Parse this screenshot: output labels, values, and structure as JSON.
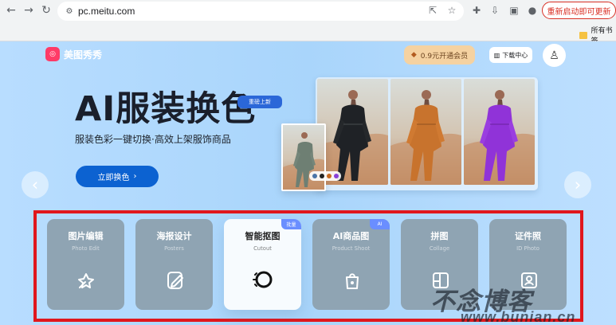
{
  "browser": {
    "url": "pc.meitu.com",
    "update_label": "重新启动即可更新",
    "bookmark_folder": "所有书签",
    "icons": [
      "back-icon",
      "forward-icon",
      "reload-icon",
      "share-icon",
      "star-icon",
      "extension-icon",
      "download-icon",
      "sidebar-icon",
      "profile-icon"
    ]
  },
  "header": {
    "brand": "美图秀秀",
    "vip_label": "0.9元开通会员",
    "download_label": "下载中心",
    "avatar_icon": "user-icon"
  },
  "hero": {
    "title": "AI服装换色",
    "badge": "重磅上新",
    "subtitle": "服装色彩一键切换·高效上架服饰商品",
    "cta": "立即换色",
    "swatch_colors": [
      "#4b75a8",
      "#222222",
      "#c86b22",
      "#8a40d9"
    ],
    "outfit_colors": [
      "#6e7f73",
      "#202226",
      "#c8732d",
      "#9033d8"
    ]
  },
  "tools": [
    {
      "title": "图片编辑",
      "subtitle": "Photo Edit",
      "icon": "magic-wand-icon",
      "active": false
    },
    {
      "title": "海报设计",
      "subtitle": "Posters",
      "icon": "edit-document-icon",
      "active": false
    },
    {
      "title": "智能抠图",
      "subtitle": "Cutout",
      "icon": "cutout-circle-icon",
      "active": true,
      "badge": "批量"
    },
    {
      "title": "AI商品图",
      "subtitle": "Product Shoot",
      "icon": "ai-product-bag-icon",
      "active": false,
      "badge": "AI"
    },
    {
      "title": "拼图",
      "subtitle": "Collage",
      "icon": "collage-grid-icon",
      "active": false
    },
    {
      "title": "证件照",
      "subtitle": "ID Photo",
      "icon": "id-photo-icon",
      "active": false
    }
  ],
  "watermark": {
    "title": "不念博客",
    "url": "www.bunian.cn"
  }
}
